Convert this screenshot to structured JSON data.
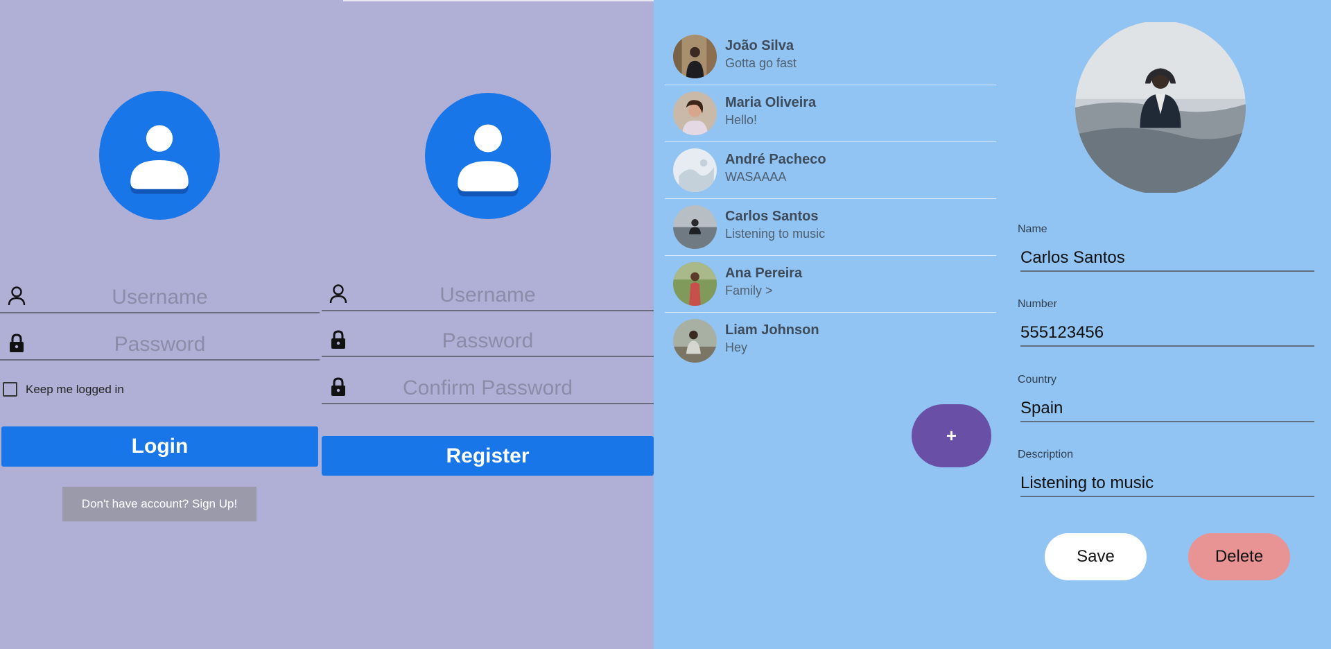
{
  "login": {
    "username_placeholder": "Username",
    "password_placeholder": "Password",
    "keep_logged_label": "Keep me logged in",
    "login_button": "Login",
    "signup_button": "Don't have account? Sign Up!"
  },
  "register": {
    "username_placeholder": "Username",
    "password_placeholder": "Password",
    "confirm_placeholder": "Confirm Password",
    "register_button": "Register"
  },
  "contacts": {
    "items": [
      {
        "name": "João Silva",
        "message": "Gotta go fast"
      },
      {
        "name": "Maria Oliveira",
        "message": "Hello!"
      },
      {
        "name": "André Pacheco",
        "message": "WASAAAA"
      },
      {
        "name": "Carlos Santos",
        "message": "Listening to music"
      },
      {
        "name": "Ana Pereira",
        "message": "Family >"
      },
      {
        "name": "Liam Johnson",
        "message": "Hey"
      }
    ],
    "add_button": "+"
  },
  "detail": {
    "name_label": "Name",
    "name_value": "Carlos Santos",
    "number_label": "Number",
    "number_value": "555123456",
    "country_label": "Country",
    "country_value": "Spain",
    "description_label": "Description",
    "description_value": "Listening to music",
    "save_button": "Save",
    "delete_button": "Delete"
  },
  "colors": {
    "primary": "#1976e8",
    "login_background": "#b0b0d6",
    "contacts_background": "#91c4f2",
    "fab": "#6a4fa6",
    "save_button": "#ffffff",
    "delete_button": "#e89494"
  }
}
